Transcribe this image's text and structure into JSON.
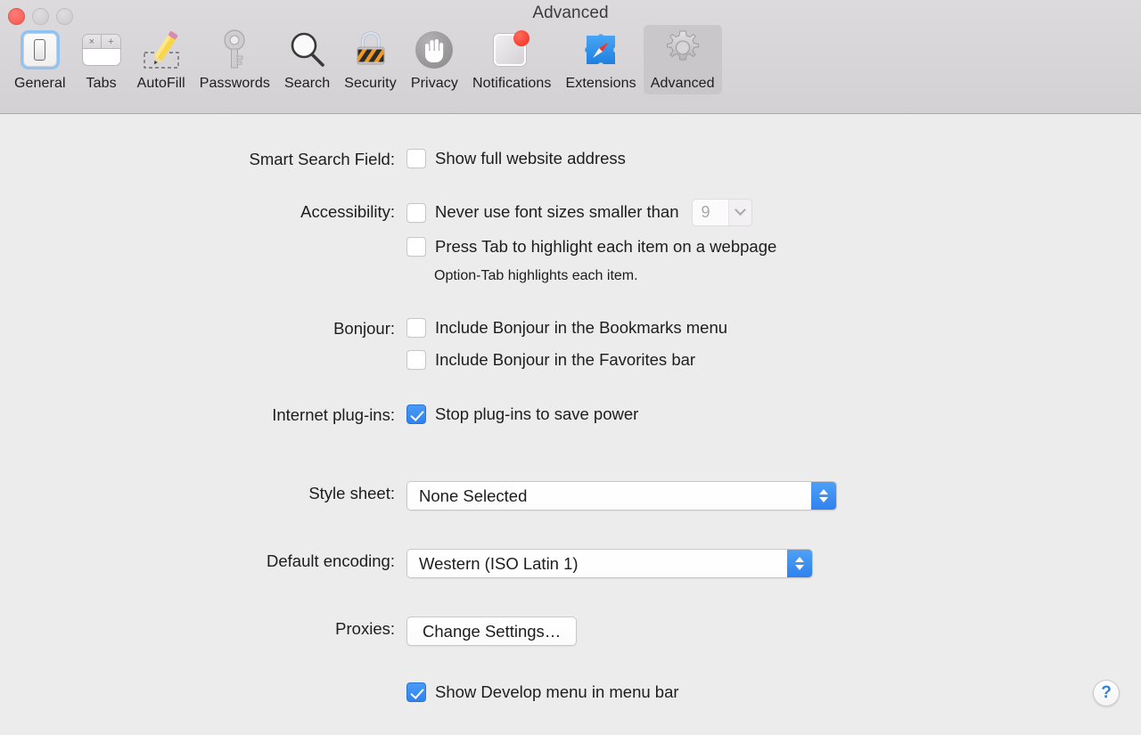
{
  "window": {
    "title": "Advanced",
    "traffic_lights": [
      {
        "name": "close",
        "color": "#fb6a62",
        "state": "active"
      },
      {
        "name": "minimize",
        "color": "#d4d2d4",
        "state": "disabled"
      },
      {
        "name": "zoom",
        "color": "#d4d2d4",
        "state": "disabled"
      }
    ]
  },
  "toolbar": {
    "tabs": [
      {
        "label": "General",
        "icon": "general-icon",
        "selected": false
      },
      {
        "label": "Tabs",
        "icon": "tabs-icon",
        "selected": false
      },
      {
        "label": "AutoFill",
        "icon": "autofill-icon",
        "selected": false
      },
      {
        "label": "Passwords",
        "icon": "key-icon",
        "selected": false
      },
      {
        "label": "Search",
        "icon": "magnifier-icon",
        "selected": false
      },
      {
        "label": "Security",
        "icon": "lock-icon",
        "selected": false
      },
      {
        "label": "Privacy",
        "icon": "hand-icon",
        "selected": false
      },
      {
        "label": "Notifications",
        "icon": "notification-badge-icon",
        "selected": false
      },
      {
        "label": "Extensions",
        "icon": "puzzle-compass-icon",
        "selected": false
      },
      {
        "label": "Advanced",
        "icon": "gear-icon",
        "selected": true
      }
    ]
  },
  "rows": {
    "smart_search": {
      "label": "Smart Search Field:",
      "checkbox": {
        "text": "Show full website address",
        "checked": false
      }
    },
    "accessibility": {
      "label": "Accessibility:",
      "font_size_checkbox": {
        "text": "Never use font sizes smaller than",
        "checked": false
      },
      "font_size_value": "9",
      "font_size_enabled": false,
      "tab_highlight_checkbox": {
        "text": "Press Tab to highlight each item on a webpage",
        "checked": false
      },
      "hint": "Option-Tab highlights each item."
    },
    "bonjour": {
      "label": "Bonjour:",
      "bookmarks_checkbox": {
        "text": "Include Bonjour in the Bookmarks menu",
        "checked": false
      },
      "favorites_checkbox": {
        "text": "Include Bonjour in the Favorites bar",
        "checked": false
      }
    },
    "plugins": {
      "label": "Internet plug-ins:",
      "checkbox": {
        "text": "Stop plug-ins to save power",
        "checked": true
      }
    },
    "style_sheet": {
      "label": "Style sheet:",
      "value": "None Selected"
    },
    "default_encoding": {
      "label": "Default encoding:",
      "value": "Western (ISO Latin 1)"
    },
    "proxies": {
      "label": "Proxies:",
      "button_label": "Change Settings…"
    },
    "develop_menu": {
      "checkbox": {
        "text": "Show Develop menu in menu bar",
        "checked": true
      }
    }
  },
  "help_button": {
    "glyph": "?"
  },
  "colors": {
    "accent_blue": "#2f82ef",
    "toolbar_bg": "#d6d4d6",
    "content_bg": "#ececec",
    "text": "#1d1d1f",
    "selected_tab_bg": "#c9c7c9",
    "disabled_text": "#a9a7a9"
  }
}
